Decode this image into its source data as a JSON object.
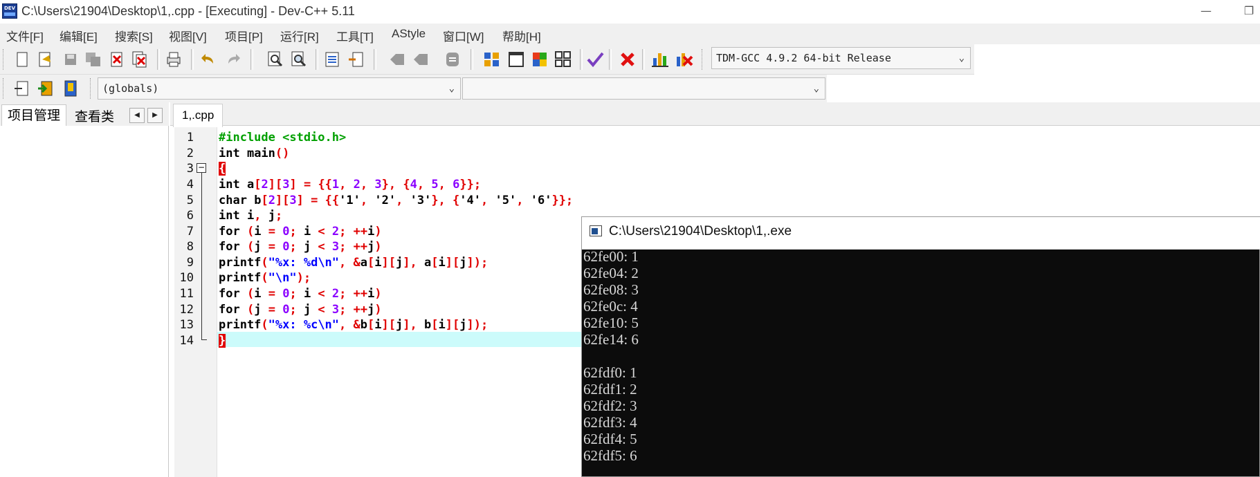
{
  "window": {
    "title": "C:\\Users\\21904\\Desktop\\1,.cpp - [Executing] - Dev-C++ 5.11",
    "icon_text": "DEV"
  },
  "menu": [
    {
      "label": "文件[F]"
    },
    {
      "label": "编辑[E]"
    },
    {
      "label": "搜索[S]"
    },
    {
      "label": "视图[V]"
    },
    {
      "label": "项目[P]"
    },
    {
      "label": "运行[R]"
    },
    {
      "label": "工具[T]"
    },
    {
      "label": "AStyle"
    },
    {
      "label": "窗口[W]"
    },
    {
      "label": "帮助[H]"
    }
  ],
  "toolbar": {
    "compiler_select": "TDM-GCC 4.9.2 64-bit Release",
    "scope_select": "(globals)",
    "member_select": ""
  },
  "left_panel": {
    "tabs": [
      "项目管理",
      "查看类"
    ]
  },
  "editor": {
    "file_tab": "1,.cpp",
    "line_numbers": [
      "1",
      "2",
      "3",
      "4",
      "5",
      "6",
      "7",
      "8",
      "9",
      "10",
      "11",
      "12",
      "13",
      "14"
    ]
  },
  "console": {
    "title": "C:\\Users\\21904\\Desktop\\1,.exe",
    "output": [
      "62fe00: 1",
      "62fe04: 2",
      "62fe08: 3",
      "62fe0c: 4",
      "62fe10: 5",
      "62fe14: 6",
      "",
      "62fdf0: 1",
      "62fdf1: 2",
      "62fdf2: 3",
      "62fdf3: 4",
      "62fdf4: 5",
      "62fdf5: 6"
    ]
  },
  "colors": {
    "keyword": "#000000",
    "preprocessor": "#00a000",
    "symbol": "#e00000",
    "number": "#8b00ff",
    "string": "#0000ff",
    "current_line": "#ccfbfb",
    "console_bg": "#0c0c0c"
  }
}
